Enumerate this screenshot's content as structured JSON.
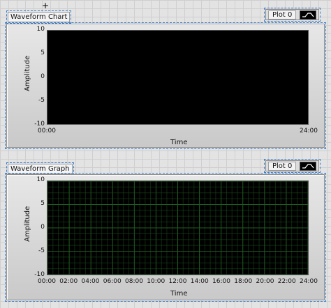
{
  "cursor_glyph": "+",
  "chart": {
    "label": "Waveform Chart",
    "legend": {
      "plot": "Plot 0",
      "icon": "waveform-icon"
    },
    "plot_bg": "#000000",
    "y_title": "Amplitude",
    "y_ticks": [
      "10",
      "5",
      "0",
      "-5",
      "-10"
    ],
    "x_title": "Time",
    "x_ticks": [
      "00:00",
      "24:00"
    ]
  },
  "graph": {
    "label": "Waveform Graph",
    "legend": {
      "plot": "Plot 0",
      "icon": "waveform-icon"
    },
    "plot_bg": "#000000",
    "grid_color": "#1f5c1f",
    "y_title": "Amplitude",
    "y_ticks": [
      "10",
      "5",
      "0",
      "-5",
      "-10"
    ],
    "x_title": "Time",
    "x_ticks": [
      "00:00",
      "02:00",
      "04:00",
      "06:00",
      "08:00",
      "10:00",
      "12:00",
      "14:00",
      "16:00",
      "18:00",
      "20:00",
      "22:00",
      "24:00"
    ]
  }
}
